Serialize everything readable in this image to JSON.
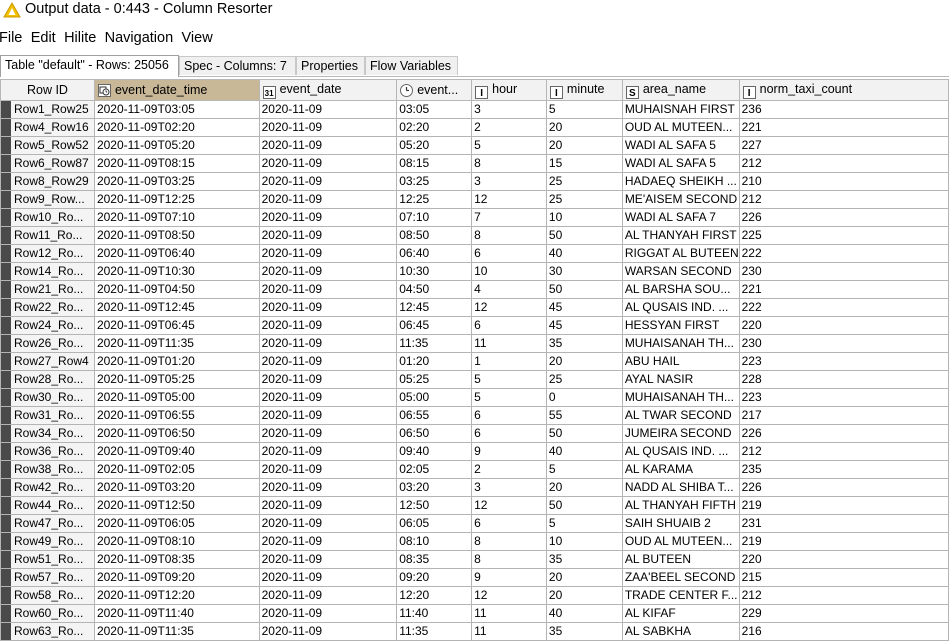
{
  "window": {
    "title": "Output data - 0:443 - Column Resorter",
    "icon": "knime-warning-triangle-icon"
  },
  "menu": [
    "File",
    "Edit",
    "Hilite",
    "Navigation",
    "View"
  ],
  "tabs": [
    {
      "label": "Table \"default\" - Rows: 25056",
      "active": true
    },
    {
      "label": "Spec - Columns: 7",
      "active": false
    },
    {
      "label": "Properties",
      "active": false
    },
    {
      "label": "Flow Variables",
      "active": false
    }
  ],
  "table": {
    "columns": [
      {
        "label": "Row ID",
        "type": "none"
      },
      {
        "label": "event_date_time",
        "type": "datetime"
      },
      {
        "label": "event_date",
        "type": "date"
      },
      {
        "label": "event...",
        "type": "time"
      },
      {
        "label": "hour",
        "type": "integer"
      },
      {
        "label": "minute",
        "type": "integer"
      },
      {
        "label": "area_name",
        "type": "string"
      },
      {
        "label": "norm_taxi_count",
        "type": "integer"
      }
    ],
    "type_glyphs": {
      "integer": "I",
      "string": "S",
      "date": "31"
    },
    "rows": [
      [
        "Row1_Row25",
        "2020-11-09T03:05",
        "2020-11-09",
        "03:05",
        "3",
        "5",
        "MUHAISNAH FIRST",
        "236"
      ],
      [
        "Row4_Row16",
        "2020-11-09T02:20",
        "2020-11-09",
        "02:20",
        "2",
        "20",
        "OUD AL MUTEEN...",
        "221"
      ],
      [
        "Row5_Row52",
        "2020-11-09T05:20",
        "2020-11-09",
        "05:20",
        "5",
        "20",
        "WADI AL SAFA 5",
        "227"
      ],
      [
        "Row6_Row87",
        "2020-11-09T08:15",
        "2020-11-09",
        "08:15",
        "8",
        "15",
        "WADI AL SAFA 5",
        "212"
      ],
      [
        "Row8_Row29",
        "2020-11-09T03:25",
        "2020-11-09",
        "03:25",
        "3",
        "25",
        "HADAEQ SHEIKH ...",
        "210"
      ],
      [
        "Row9_Row...",
        "2020-11-09T12:25",
        "2020-11-09",
        "12:25",
        "12",
        "25",
        "ME'AISEM SECOND",
        "212"
      ],
      [
        "Row10_Ro...",
        "2020-11-09T07:10",
        "2020-11-09",
        "07:10",
        "7",
        "10",
        "WADI AL SAFA 7",
        "226"
      ],
      [
        "Row11_Ro...",
        "2020-11-09T08:50",
        "2020-11-09",
        "08:50",
        "8",
        "50",
        "AL THANYAH FIRST",
        "225"
      ],
      [
        "Row12_Ro...",
        "2020-11-09T06:40",
        "2020-11-09",
        "06:40",
        "6",
        "40",
        "RIGGAT AL BUTEEN",
        "222"
      ],
      [
        "Row14_Ro...",
        "2020-11-09T10:30",
        "2020-11-09",
        "10:30",
        "10",
        "30",
        "WARSAN SECOND",
        "230"
      ],
      [
        "Row21_Ro...",
        "2020-11-09T04:50",
        "2020-11-09",
        "04:50",
        "4",
        "50",
        "AL BARSHA SOU...",
        "221"
      ],
      [
        "Row22_Ro...",
        "2020-11-09T12:45",
        "2020-11-09",
        "12:45",
        "12",
        "45",
        "AL QUSAIS IND. ...",
        "222"
      ],
      [
        "Row24_Ro...",
        "2020-11-09T06:45",
        "2020-11-09",
        "06:45",
        "6",
        "45",
        "HESSYAN FIRST",
        "220"
      ],
      [
        "Row26_Ro...",
        "2020-11-09T11:35",
        "2020-11-09",
        "11:35",
        "11",
        "35",
        "MUHAISANAH TH...",
        "230"
      ],
      [
        "Row27_Row4",
        "2020-11-09T01:20",
        "2020-11-09",
        "01:20",
        "1",
        "20",
        "ABU HAIL",
        "223"
      ],
      [
        "Row28_Ro...",
        "2020-11-09T05:25",
        "2020-11-09",
        "05:25",
        "5",
        "25",
        "AYAL NASIR",
        "228"
      ],
      [
        "Row30_Ro...",
        "2020-11-09T05:00",
        "2020-11-09",
        "05:00",
        "5",
        "0",
        "MUHAISANAH TH...",
        "223"
      ],
      [
        "Row31_Ro...",
        "2020-11-09T06:55",
        "2020-11-09",
        "06:55",
        "6",
        "55",
        "AL TWAR SECOND",
        "217"
      ],
      [
        "Row34_Ro...",
        "2020-11-09T06:50",
        "2020-11-09",
        "06:50",
        "6",
        "50",
        "JUMEIRA SECOND",
        "226"
      ],
      [
        "Row36_Ro...",
        "2020-11-09T09:40",
        "2020-11-09",
        "09:40",
        "9",
        "40",
        "AL QUSAIS IND. ...",
        "212"
      ],
      [
        "Row38_Ro...",
        "2020-11-09T02:05",
        "2020-11-09",
        "02:05",
        "2",
        "5",
        "AL KARAMA",
        "235"
      ],
      [
        "Row42_Ro...",
        "2020-11-09T03:20",
        "2020-11-09",
        "03:20",
        "3",
        "20",
        "NADD AL SHIBA T...",
        "226"
      ],
      [
        "Row44_Ro...",
        "2020-11-09T12:50",
        "2020-11-09",
        "12:50",
        "12",
        "50",
        "AL THANYAH FIFTH",
        "219"
      ],
      [
        "Row47_Ro...",
        "2020-11-09T06:05",
        "2020-11-09",
        "06:05",
        "6",
        "5",
        "SAIH SHUAIB 2",
        "231"
      ],
      [
        "Row49_Ro...",
        "2020-11-09T08:10",
        "2020-11-09",
        "08:10",
        "8",
        "10",
        "OUD AL MUTEEN...",
        "219"
      ],
      [
        "Row51_Ro...",
        "2020-11-09T08:35",
        "2020-11-09",
        "08:35",
        "8",
        "35",
        "AL BUTEEN",
        "220"
      ],
      [
        "Row57_Ro...",
        "2020-11-09T09:20",
        "2020-11-09",
        "09:20",
        "9",
        "20",
        "ZAA'BEEL SECOND",
        "215"
      ],
      [
        "Row58_Ro...",
        "2020-11-09T12:20",
        "2020-11-09",
        "12:20",
        "12",
        "20",
        "TRADE CENTER F...",
        "212"
      ],
      [
        "Row60_Ro...",
        "2020-11-09T11:40",
        "2020-11-09",
        "11:40",
        "11",
        "40",
        "AL KIFAF",
        "229"
      ],
      [
        "Row63_Ro...",
        "2020-11-09T11:35",
        "2020-11-09",
        "11:35",
        "11",
        "35",
        "AL SABKHA",
        "216"
      ]
    ]
  }
}
